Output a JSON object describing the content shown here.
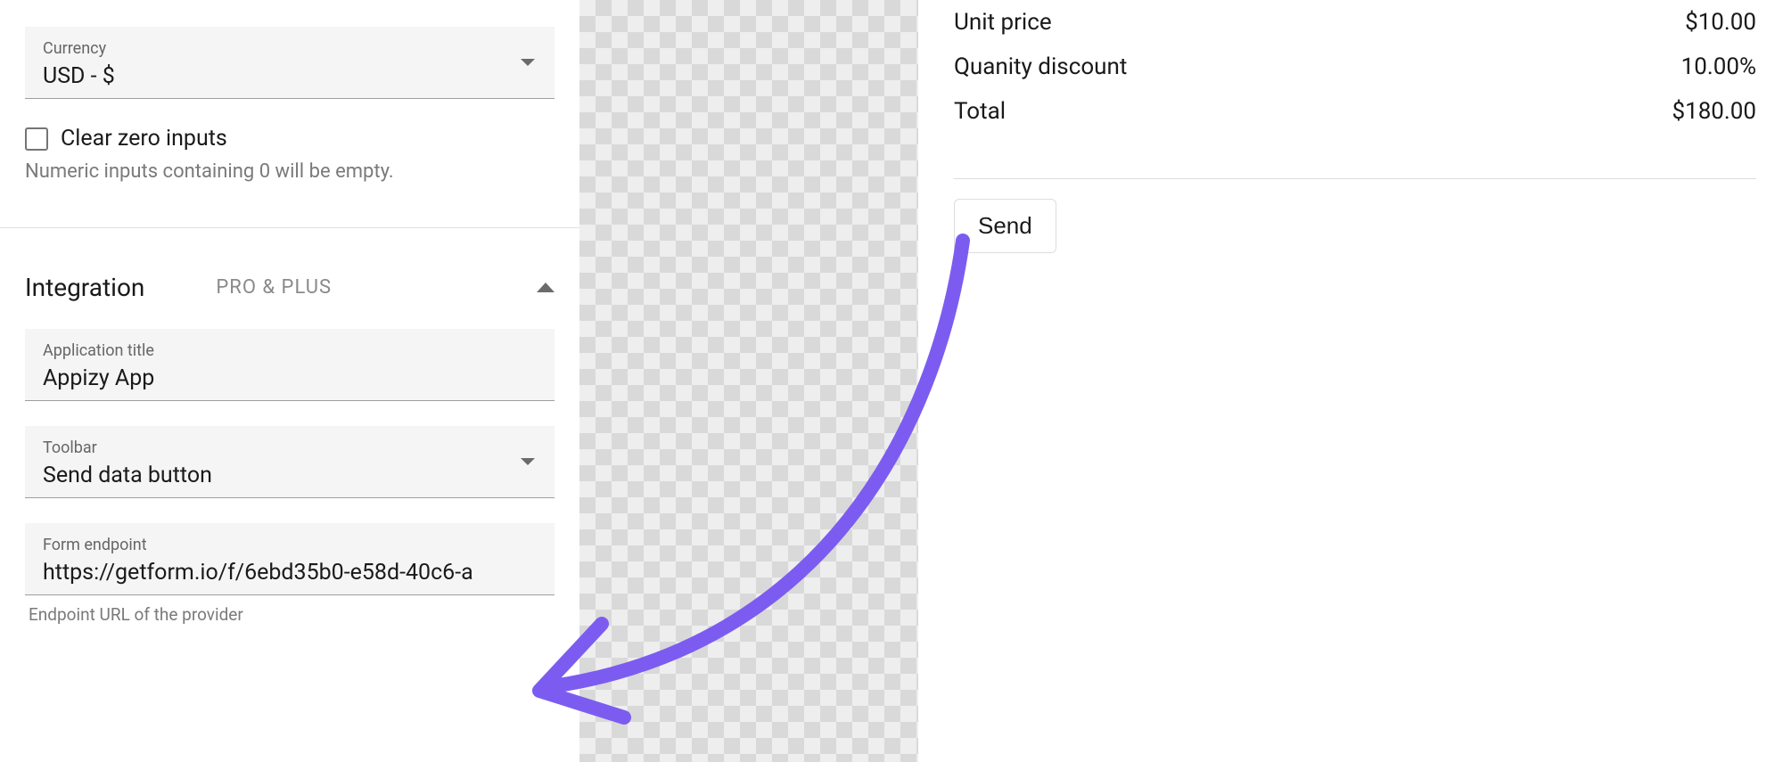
{
  "settings": {
    "currency": {
      "label": "Currency",
      "value": "USD - $"
    },
    "clear_zero": {
      "label": "Clear zero inputs",
      "helper": "Numeric inputs containing 0 will be empty."
    }
  },
  "integration": {
    "title": "Integration",
    "badge": "PRO & PLUS",
    "app_title": {
      "label": "Application title",
      "value": "Appizy App"
    },
    "toolbar": {
      "label": "Toolbar",
      "value": "Send data button"
    },
    "endpoint": {
      "label": "Form endpoint",
      "value": "https://getform.io/f/6ebd35b0-e58d-40c6-a",
      "helper": "Endpoint URL of the provider"
    }
  },
  "preview": {
    "rows": [
      {
        "label": "Unit price",
        "value": "$10.00"
      },
      {
        "label": "Quanity discount",
        "value": "10.00%"
      },
      {
        "label": "Total",
        "value": "$180.00"
      }
    ],
    "send_label": "Send"
  },
  "colors": {
    "annotation": "#7c5cf0"
  }
}
